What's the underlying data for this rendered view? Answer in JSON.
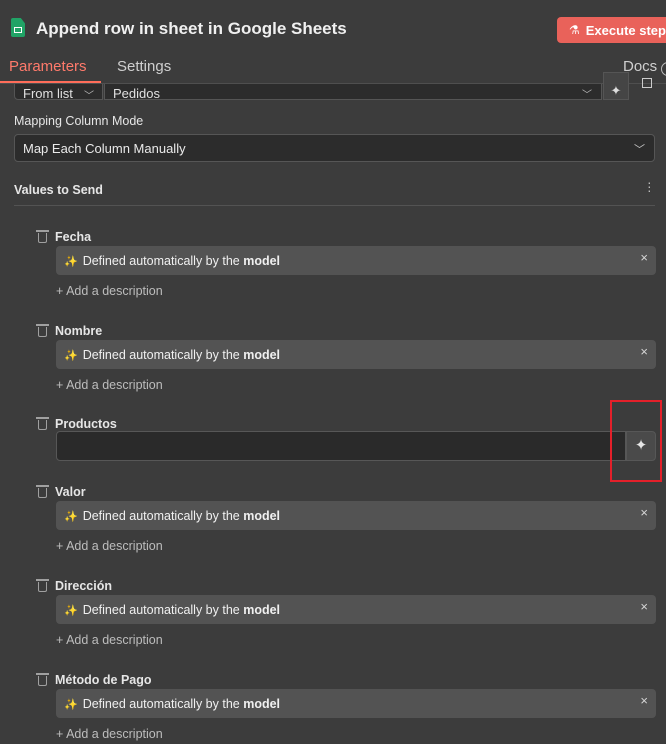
{
  "header": {
    "title": "Append row in sheet in Google Sheets",
    "execute_label": "Execute step",
    "tabs": {
      "parameters": "Parameters",
      "settings": "Settings"
    },
    "docs_label": "Docs"
  },
  "document_row": {
    "mode": "From list",
    "value": "Pedidos"
  },
  "mapping": {
    "label": "Mapping Column Mode",
    "value": "Map Each Column Manually"
  },
  "values": {
    "label": "Values to Send",
    "fields": [
      {
        "name": "Fecha",
        "auto_prefix": "Defined automatically by the",
        "auto_emph": "model",
        "add_desc": "+ Add a description"
      },
      {
        "name": "Nombre",
        "auto_prefix": "Defined automatically by the",
        "auto_emph": "model",
        "add_desc": "+ Add a description"
      },
      {
        "name": "Productos",
        "value": ""
      },
      {
        "name": "Valor",
        "auto_prefix": "Defined automatically by the",
        "auto_emph": "model",
        "add_desc": "+ Add a description"
      },
      {
        "name": "Dirección",
        "auto_prefix": "Defined automatically by the",
        "auto_emph": "model",
        "add_desc": "+ Add a description"
      },
      {
        "name": "Método de Pago",
        "auto_prefix": "Defined automatically by the",
        "auto_emph": "model",
        "add_desc": "+ Add a description"
      }
    ]
  },
  "colors": {
    "accent": "#ff6d5a",
    "execute_bg": "#e9625a",
    "highlight": "#e4202a",
    "sheets_green": "#21a366"
  },
  "icons": {
    "header": "google-sheets-icon",
    "node": "robot-icon",
    "field": "trash-icon",
    "auto": "sparkle-icon",
    "clear": "close-icon"
  }
}
